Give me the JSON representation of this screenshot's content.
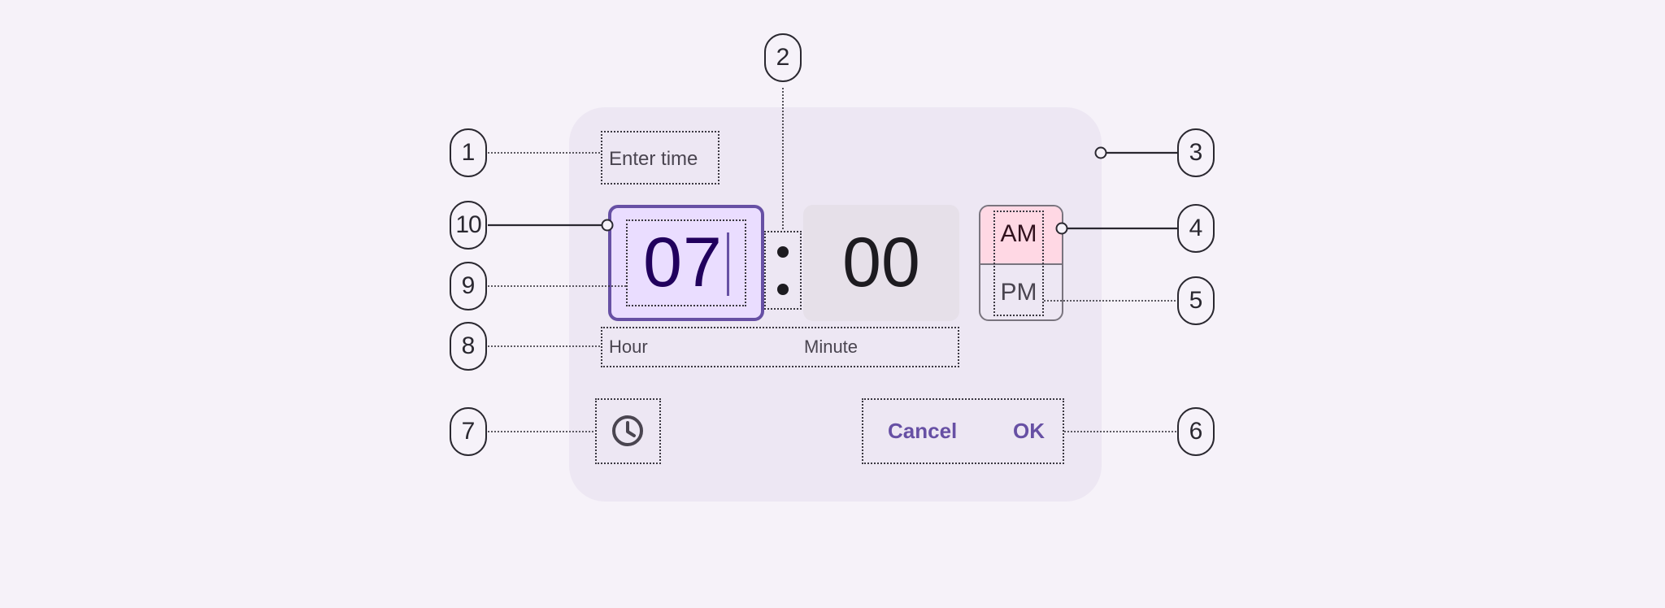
{
  "dialog": {
    "title": "Enter time",
    "hour_value": "07",
    "minute_value": "00",
    "am_label": "AM",
    "pm_label": "PM",
    "hour_label": "Hour",
    "minute_label": "Minute",
    "cancel_label": "Cancel",
    "ok_label": "OK",
    "selected_period": "AM",
    "icon": "clock-icon"
  },
  "callouts": [
    "1",
    "2",
    "3",
    "4",
    "5",
    "6",
    "7",
    "8",
    "9",
    "10"
  ],
  "colors": {
    "background": "#f6f2f9",
    "container": "#ede7f3",
    "primary": "#6750a4",
    "hour_field_bg": "#eaddff",
    "hour_text": "#21005d",
    "minute_field_bg": "#e6e0e9",
    "am_selected_bg": "#ffd8e4"
  }
}
